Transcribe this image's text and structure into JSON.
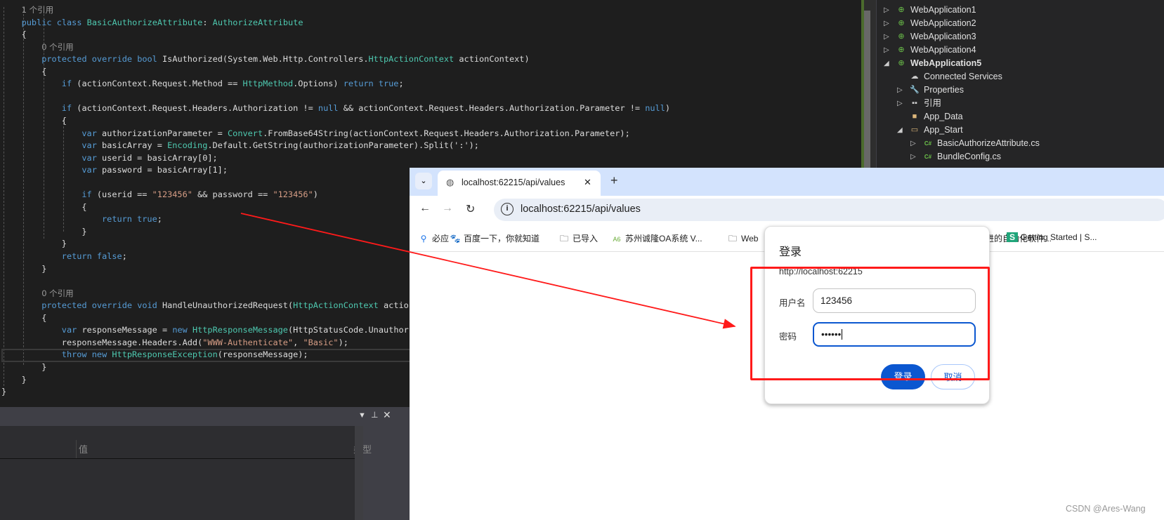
{
  "editor": {
    "lines": [
      {
        "indent": 1,
        "ref": true,
        "tokens": [
          [
            "1 个引用",
            "r"
          ]
        ]
      },
      {
        "indent": 1,
        "tokens": [
          [
            "public class ",
            "k"
          ],
          [
            "BasicAuthorizeAttribute",
            "t"
          ],
          [
            ": ",
            "p"
          ],
          [
            "AuthorizeAttribute",
            "t"
          ]
        ]
      },
      {
        "indent": 1,
        "tokens": [
          [
            "{",
            "p"
          ]
        ]
      },
      {
        "indent": 2,
        "ref": true,
        "tokens": [
          [
            "0 个引用",
            "r"
          ]
        ]
      },
      {
        "indent": 2,
        "tokens": [
          [
            "protected override bool ",
            "k"
          ],
          [
            "IsAuthorized(System.Web.Http.Controllers.",
            "p"
          ],
          [
            "HttpActionContext",
            "t"
          ],
          [
            " actionContext)",
            "p"
          ]
        ]
      },
      {
        "indent": 2,
        "tokens": [
          [
            "{",
            "p"
          ]
        ]
      },
      {
        "indent": 3,
        "tokens": [
          [
            "if",
            "k"
          ],
          [
            " (actionContext.Request.Method == ",
            "p"
          ],
          [
            "HttpMethod",
            "t"
          ],
          [
            ".Options) ",
            "p"
          ],
          [
            "return true",
            "k"
          ],
          [
            ";",
            "p"
          ]
        ]
      },
      {
        "indent": 3,
        "tokens": []
      },
      {
        "indent": 3,
        "tokens": [
          [
            "if",
            "k"
          ],
          [
            " (actionContext.Request.Headers.Authorization != ",
            "p"
          ],
          [
            "null",
            "k"
          ],
          [
            " && actionContext.Request.Headers.Authorization.Parameter != ",
            "p"
          ],
          [
            "null",
            "k"
          ],
          [
            ")",
            "p"
          ]
        ]
      },
      {
        "indent": 3,
        "tokens": [
          [
            "{",
            "p"
          ]
        ]
      },
      {
        "indent": 4,
        "tokens": [
          [
            "var",
            "k"
          ],
          [
            " authorizationParameter = ",
            "p"
          ],
          [
            "Convert",
            "t"
          ],
          [
            ".FromBase64String(actionContext.Request.Headers.Authorization.Parameter);",
            "p"
          ]
        ]
      },
      {
        "indent": 4,
        "tokens": [
          [
            "var",
            "k"
          ],
          [
            " basicArray = ",
            "p"
          ],
          [
            "Encoding",
            "t"
          ],
          [
            ".Default.GetString(authorizationParameter).Split(':');",
            "p"
          ]
        ]
      },
      {
        "indent": 4,
        "tokens": [
          [
            "var",
            "k"
          ],
          [
            " userid = basicArray[0];",
            "p"
          ]
        ]
      },
      {
        "indent": 4,
        "tokens": [
          [
            "var",
            "k"
          ],
          [
            " password = basicArray[1];",
            "p"
          ]
        ]
      },
      {
        "indent": 4,
        "tokens": []
      },
      {
        "indent": 4,
        "tokens": [
          [
            "if",
            "k"
          ],
          [
            " (userid == ",
            "p"
          ],
          [
            "\"123456\"",
            "s"
          ],
          [
            " && password == ",
            "p"
          ],
          [
            "\"123456\"",
            "s"
          ],
          [
            ")",
            "p"
          ]
        ]
      },
      {
        "indent": 4,
        "tokens": [
          [
            "{",
            "p"
          ]
        ]
      },
      {
        "indent": 5,
        "tokens": [
          [
            "return true",
            "k"
          ],
          [
            ";",
            "p"
          ]
        ]
      },
      {
        "indent": 4,
        "tokens": [
          [
            "}",
            "p"
          ]
        ]
      },
      {
        "indent": 3,
        "tokens": [
          [
            "}",
            "p"
          ]
        ]
      },
      {
        "indent": 3,
        "tokens": [
          [
            "return false",
            "k"
          ],
          [
            ";",
            "p"
          ]
        ]
      },
      {
        "indent": 2,
        "tokens": [
          [
            "}",
            "p"
          ]
        ]
      },
      {
        "indent": 2,
        "tokens": []
      },
      {
        "indent": 2,
        "ref": true,
        "tokens": [
          [
            "0 个引用",
            "r"
          ]
        ]
      },
      {
        "indent": 2,
        "tokens": [
          [
            "protected override void ",
            "k"
          ],
          [
            "HandleUnauthorizedRequest(",
            "p"
          ],
          [
            "HttpActionContext",
            "t"
          ],
          [
            " actio",
            "p"
          ]
        ]
      },
      {
        "indent": 2,
        "tokens": [
          [
            "{",
            "p"
          ]
        ]
      },
      {
        "indent": 3,
        "tokens": [
          [
            "var",
            "k"
          ],
          [
            " responseMessage = ",
            "p"
          ],
          [
            "new ",
            "k"
          ],
          [
            "HttpResponseMessage",
            "t"
          ],
          [
            "(HttpStatusCode.Unauthor",
            "p"
          ]
        ]
      },
      {
        "indent": 3,
        "tokens": [
          [
            "responseMessage.Headers.Add(",
            "p"
          ],
          [
            "\"WWW-Authenticate\"",
            "s"
          ],
          [
            ", ",
            "p"
          ],
          [
            "\"Basic\"",
            "s"
          ],
          [
            ");",
            "p"
          ]
        ]
      },
      {
        "indent": 3,
        "tokens": [
          [
            "throw new ",
            "k"
          ],
          [
            "HttpResponseException",
            "t"
          ],
          [
            "(responseMessage);",
            "p"
          ]
        ]
      },
      {
        "indent": 2,
        "tokens": [
          [
            "}",
            "p"
          ]
        ]
      },
      {
        "indent": 1,
        "tokens": [
          [
            "}",
            "p"
          ]
        ]
      },
      {
        "indent": 0,
        "tokens": [
          [
            "}",
            "p"
          ]
        ]
      }
    ]
  },
  "solution_explorer": {
    "items": [
      {
        "level": 0,
        "label": "WebApplication1",
        "expander": "collapsed",
        "icon": "web-project-icon",
        "bold": false
      },
      {
        "level": 0,
        "label": "WebApplication2",
        "expander": "collapsed",
        "icon": "web-project-icon",
        "bold": false
      },
      {
        "level": 0,
        "label": "WebApplication3",
        "expander": "collapsed",
        "icon": "web-project-icon",
        "bold": false
      },
      {
        "level": 0,
        "label": "WebApplication4",
        "expander": "collapsed",
        "icon": "web-project-icon",
        "bold": false
      },
      {
        "level": 0,
        "label": "WebApplication5",
        "expander": "expanded",
        "icon": "web-project-icon",
        "bold": true
      },
      {
        "level": 1,
        "label": "Connected Services",
        "expander": "none",
        "icon": "cloud-icon"
      },
      {
        "level": 1,
        "label": "Properties",
        "expander": "collapsed",
        "icon": "wrench-icon"
      },
      {
        "level": 1,
        "label": "引用",
        "expander": "collapsed",
        "icon": "references-icon"
      },
      {
        "level": 1,
        "label": "App_Data",
        "expander": "none",
        "icon": "folder-icon"
      },
      {
        "level": 1,
        "label": "App_Start",
        "expander": "expanded",
        "icon": "folder-open-icon"
      },
      {
        "level": 2,
        "label": "BasicAuthorizeAttribute.cs",
        "expander": "collapsed",
        "icon": "csharp-file-icon"
      },
      {
        "level": 2,
        "label": "BundleConfig.cs",
        "expander": "collapsed",
        "icon": "csharp-file-icon"
      }
    ]
  },
  "bottom_panel": {
    "col_value": "值",
    "col_type": "类型"
  },
  "browser": {
    "tab_title": "localhost:62215/api/values",
    "url": "localhost:62215/api/values",
    "bookmarks": [
      {
        "label": "必应",
        "icon": "search-icon"
      },
      {
        "label": "百度一下，你就知道",
        "icon": "baidu-paw-icon"
      },
      {
        "label": "已导入",
        "icon": "folder-icon"
      },
      {
        "label": "苏州诚隆OA系统 V...",
        "icon": "site-icon"
      },
      {
        "label": "Web",
        "icon": "folder-icon"
      },
      {
        "label": "进的自动化软件...",
        "icon": ""
      },
      {
        "label": "Getting Started | S...",
        "icon": "s-logo-icon"
      }
    ]
  },
  "dialog": {
    "title": "登录",
    "origin": "http://localhost:62215",
    "username_label": "用户名",
    "username_value": "123456",
    "password_label": "密码",
    "password_value": "••••••",
    "login_button": "登录",
    "cancel_button": "取消"
  },
  "annotation_color": "#ff1a1a",
  "watermark": "CSDN @Ares-Wang"
}
